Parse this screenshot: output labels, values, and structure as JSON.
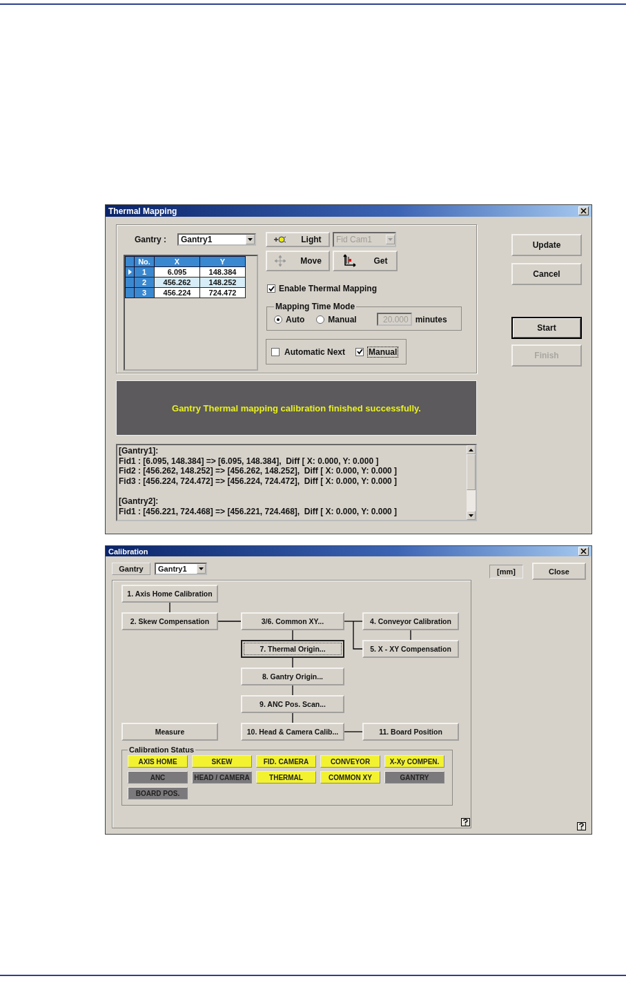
{
  "thermal_window": {
    "title": "Thermal Mapping",
    "gantry_label": "Gantry :",
    "gantry_select": "Gantry1",
    "light_button": "Light",
    "camera_select": {
      "value": "Fid Cam1",
      "disabled": true
    },
    "move_button": "Move",
    "get_button": "Get",
    "table": {
      "columns": [
        "No.",
        "X",
        "Y"
      ],
      "rows": [
        {
          "cells": [
            "1",
            "6.095",
            "148.384"
          ],
          "current": true,
          "selected": false
        },
        {
          "cells": [
            "2",
            "456.262",
            "148.252"
          ],
          "current": false,
          "selected": true
        },
        {
          "cells": [
            "3",
            "456.224",
            "724.472"
          ],
          "current": false,
          "selected": false
        }
      ]
    },
    "enable_checkbox": {
      "label": "Enable Thermal Mapping",
      "checked": true
    },
    "time_mode": {
      "title": "Mapping Time Mode",
      "options": [
        {
          "label": "Auto",
          "selected": true
        },
        {
          "label": "Manual",
          "selected": false
        }
      ],
      "minutes_field": {
        "value": "20.000",
        "disabled": true
      },
      "unit": "minutes"
    },
    "next_options": [
      {
        "label": "Automatic Next",
        "checked": false,
        "focused": false
      },
      {
        "label": "Manual",
        "checked": true,
        "focused": true
      }
    ],
    "buttons": [
      {
        "label": "Update",
        "kind": "normal"
      },
      {
        "label": "Cancel",
        "kind": "normal"
      },
      {
        "label": "Start",
        "kind": "default"
      },
      {
        "label": "Finish",
        "kind": "disabled"
      }
    ],
    "message": "Gantry Thermal mapping calibration finished successfully.",
    "log": [
      [
        "[Gantry1]:",
        "Fid1 : [6.095, 148.384] => [6.095, 148.384],  Diff [ X: 0.000, Y: 0.000 ]",
        "Fid2 : [456.262, 148.252] => [456.262, 148.252],  Diff [ X: 0.000, Y: 0.000 ]",
        "Fid3 : [456.224, 724.472] => [456.224, 724.472],  Diff [ X: 0.000, Y: 0.000 ]"
      ],
      [
        "[Gantry2]:",
        "Fid1 : [456.221, 724.468] => [456.221, 724.468],  Diff [ X: 0.000, Y: 0.000 ]"
      ]
    ]
  },
  "calibration_window": {
    "title": "Calibration",
    "gantry_label": "Gantry",
    "gantry_select": "Gantry1",
    "unit": "[mm]",
    "close_button": "Close",
    "steps": [
      {
        "label": "1. Axis Home Calibration",
        "focused": false
      },
      {
        "label": "2. Skew Compensation",
        "focused": false
      },
      {
        "label": "3/6. Common XY...",
        "focused": false
      },
      {
        "label": "4. Conveyor Calibration",
        "focused": false
      },
      {
        "label": "7. Thermal Origin...",
        "focused": true
      },
      {
        "label": "5. X - XY Compensation",
        "focused": false
      },
      {
        "label": "8. Gantry Origin...",
        "focused": false
      },
      {
        "label": "9. ANC Pos. Scan...",
        "focused": false
      },
      {
        "label": "Measure",
        "focused": false
      },
      {
        "label": "10. Head & Camera Calib...",
        "focused": false
      },
      {
        "label": "11. Board Position",
        "focused": false
      }
    ],
    "status_title": "Calibration Status",
    "status": [
      {
        "label": "AXIS HOME",
        "color": "#f2f230"
      },
      {
        "label": "SKEW",
        "color": "#f2f230"
      },
      {
        "label": "FID. CAMERA",
        "color": "#f2f230"
      },
      {
        "label": "CONVEYOR",
        "color": "#f2f230"
      },
      {
        "label": "X-Xy COMPEN.",
        "color": "#f2f230"
      },
      {
        "label": "ANC",
        "color": "#7b797b"
      },
      {
        "label": "HEAD / CAMERA",
        "color": "#7b797b"
      },
      {
        "label": "THERMAL",
        "color": "#f2f230"
      },
      {
        "label": "COMMON XY",
        "color": "#f2f230"
      },
      {
        "label": "GANTRY",
        "color": "#7b797b"
      },
      {
        "label": "BOARD POS.",
        "color": "#7b797b"
      }
    ]
  }
}
